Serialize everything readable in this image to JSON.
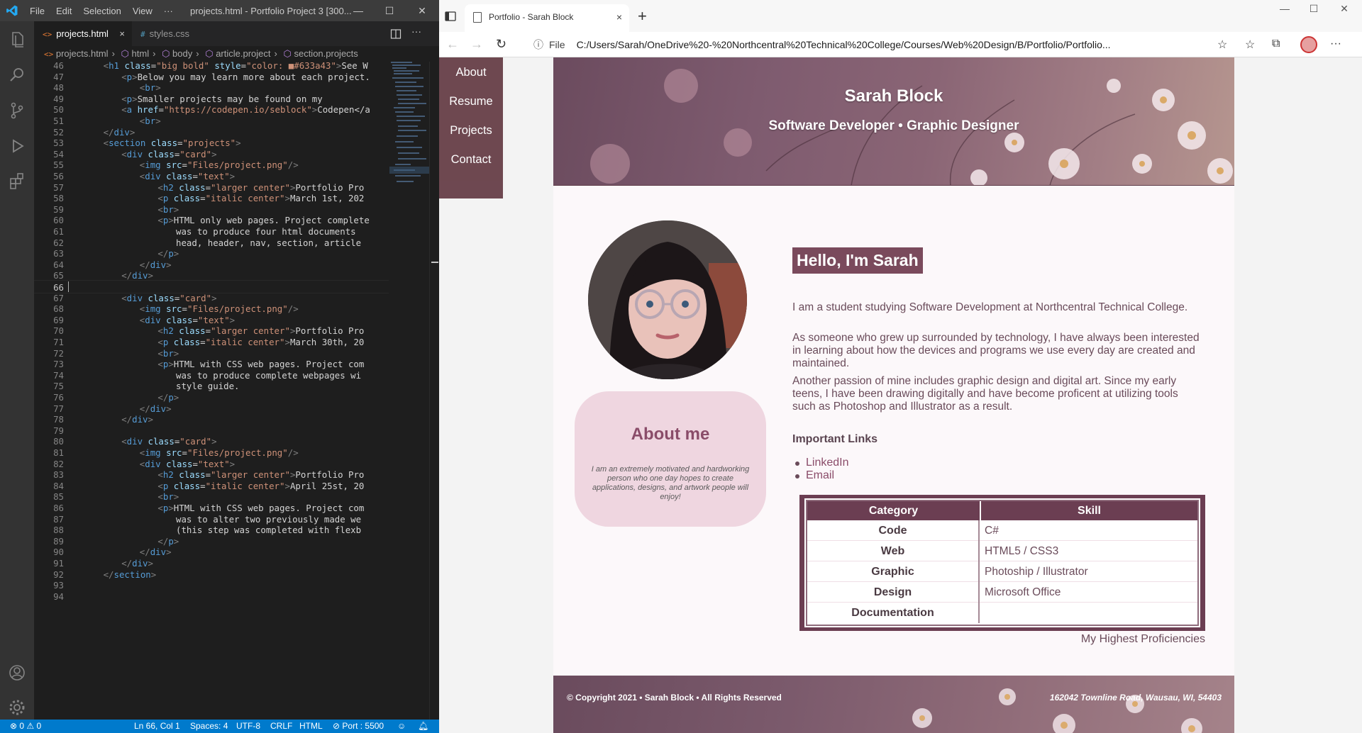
{
  "vscode": {
    "menu": [
      "File",
      "Edit",
      "Selection",
      "View",
      "···"
    ],
    "title": "projects.html - Portfolio Project 3 [300...",
    "tabs": [
      {
        "icon": "<>",
        "label": "projects.html",
        "close": "×"
      },
      {
        "icon": "#",
        "label": "styles.css",
        "close": ""
      }
    ],
    "breadcrumb": [
      "projects.html",
      "html",
      "body",
      "article.project",
      "section.projects"
    ],
    "lines": [
      {
        "n": "46",
        "code": "<h1 class=\"big bold\" style=\"color: ■#633a43\">See W",
        "indent": 4
      },
      {
        "n": "47",
        "code": "<p>Below you may learn more about each project.",
        "indent": 8
      },
      {
        "n": "48",
        "code": "<br>",
        "indent": 12
      },
      {
        "n": "49",
        "code": "<p>Smaller projects may be found on my",
        "indent": 8
      },
      {
        "n": "50",
        "code": "<a href=\"https://codepen.io/seblock\">Codepen</a",
        "indent": 8
      },
      {
        "n": "51",
        "code": "<br>",
        "indent": 12
      },
      {
        "n": "52",
        "code": "</div>",
        "indent": 4
      },
      {
        "n": "53",
        "code": "<section class=\"projects\">",
        "indent": 4
      },
      {
        "n": "54",
        "code": "<div class=\"card\">",
        "indent": 8
      },
      {
        "n": "55",
        "code": "<img src=\"Files/project.png\"/>",
        "indent": 12
      },
      {
        "n": "56",
        "code": "<div class=\"text\">",
        "indent": 12
      },
      {
        "n": "57",
        "code": "<h2 class=\"larger center\">Portfolio Pro",
        "indent": 16
      },
      {
        "n": "58",
        "code": "<p class=\"italic center\">March 1st, 202",
        "indent": 16
      },
      {
        "n": "59",
        "code": "<br>",
        "indent": 16
      },
      {
        "n": "60",
        "code": "<p>HTML only web pages. Project complete",
        "indent": 16
      },
      {
        "n": "61",
        "code": "was to produce four html documents ",
        "indent": 20
      },
      {
        "n": "62",
        "code": "head, header, nav, section, article",
        "indent": 20
      },
      {
        "n": "63",
        "code": "</p>",
        "indent": 16
      },
      {
        "n": "64",
        "code": "</div>",
        "indent": 12
      },
      {
        "n": "65",
        "code": "</div>",
        "indent": 8
      },
      {
        "n": "66",
        "code": "",
        "indent": 0
      },
      {
        "n": "67",
        "code": "<div class=\"card\">",
        "indent": 8
      },
      {
        "n": "68",
        "code": "<img src=\"Files/project.png\"/>",
        "indent": 12
      },
      {
        "n": "69",
        "code": "<div class=\"text\">",
        "indent": 12
      },
      {
        "n": "70",
        "code": "<h2 class=\"larger center\">Portfolio Pro",
        "indent": 16
      },
      {
        "n": "71",
        "code": "<p class=\"italic center\">March 30th, 20",
        "indent": 16
      },
      {
        "n": "72",
        "code": "<br>",
        "indent": 16
      },
      {
        "n": "73",
        "code": "<p>HTML with CSS web pages. Project com",
        "indent": 16
      },
      {
        "n": "74",
        "code": "was to produce complete webpages wi",
        "indent": 20
      },
      {
        "n": "75",
        "code": "style guide.",
        "indent": 20
      },
      {
        "n": "76",
        "code": "</p>",
        "indent": 16
      },
      {
        "n": "77",
        "code": "</div>",
        "indent": 12
      },
      {
        "n": "78",
        "code": "</div>",
        "indent": 8
      },
      {
        "n": "79",
        "code": "",
        "indent": 0
      },
      {
        "n": "80",
        "code": "<div class=\"card\">",
        "indent": 8
      },
      {
        "n": "81",
        "code": "<img src=\"Files/project.png\"/>",
        "indent": 12
      },
      {
        "n": "82",
        "code": "<div class=\"text\">",
        "indent": 12
      },
      {
        "n": "83",
        "code": "<h2 class=\"larger center\">Portfolio Pro",
        "indent": 16
      },
      {
        "n": "84",
        "code": "<p class=\"italic center\">April 25st, 20",
        "indent": 16
      },
      {
        "n": "85",
        "code": "<br>",
        "indent": 16
      },
      {
        "n": "86",
        "code": "<p>HTML with CSS web pages. Project com",
        "indent": 16
      },
      {
        "n": "87",
        "code": "was to alter two previously made we",
        "indent": 20
      },
      {
        "n": "88",
        "code": "(this step was completed with flexb",
        "indent": 20
      },
      {
        "n": "89",
        "code": "</p>",
        "indent": 16
      },
      {
        "n": "90",
        "code": "</div>",
        "indent": 12
      },
      {
        "n": "91",
        "code": "</div>",
        "indent": 8
      },
      {
        "n": "92",
        "code": "</section>",
        "indent": 4
      },
      {
        "n": "93",
        "code": "",
        "indent": 0
      },
      {
        "n": "94",
        "code": "",
        "indent": 0
      }
    ],
    "current_line": "66",
    "status": {
      "problems": "⊗ 0 ⚠ 0",
      "position": "Ln 66, Col 1",
      "spaces": "Spaces: 4",
      "encoding": "UTF-8",
      "eol": "CRLF",
      "language": "HTML",
      "port": "⊘ Port : 5500"
    },
    "accent_color": "#007acc"
  },
  "browser": {
    "tab_title": "Portfolio - Sarah Block",
    "tab_close": "×",
    "new_tab": "+",
    "address_prefix": "File",
    "address": "C:/Users/Sarah/OneDrive%20-%20Northcentral%20Technical%20College/Courses/Web%20Design/B/Portfolio/Portfolio...",
    "window_controls": [
      "—",
      "☐",
      "✕"
    ]
  },
  "site": {
    "nav": [
      "About",
      "Resume",
      "Projects",
      "Contact"
    ],
    "name": "Sarah Block",
    "tagline": "Software Developer • Graphic Designer",
    "about_card": {
      "title": "About me",
      "text": "I am an extremely motivated and hardworking person who one day hopes to create applications, designs, and artwork people will enjoy!"
    },
    "hello": "Hello, I'm Sarah",
    "paragraphs": [
      "I am a student studying Software Development at Northcentral Technical College.",
      "As someone who grew up surrounded by technology, I have always been interested in learning about how the devices and programs we use every day are created and maintained.",
      "Another passion of mine includes graphic design and digital art. Since my early teens, I have been drawing digitally and have become proficent at utilizing tools such as Photoshop and Illustrator as a result."
    ],
    "links_title": "Important Links",
    "links": [
      "LinkedIn",
      "Email"
    ],
    "skills": {
      "headers": [
        "Category",
        "Skill"
      ],
      "rows": [
        [
          "Code",
          "C#"
        ],
        [
          "Web",
          "HTML5 / CSS3"
        ],
        [
          "Graphic",
          "Photoship / Illustrator"
        ],
        [
          "Design",
          "Microsoft Office"
        ],
        [
          "Documentation",
          ""
        ]
      ],
      "caption": "My Highest Proficiencies"
    },
    "footer": {
      "copyright": "© Copyright 2021 • Sarah Block • All Rights Reserved",
      "address": "162042 Townline Road, Wausau, WI, 54403"
    },
    "colors": {
      "brand": "#633a43",
      "accent": "#8a4c69",
      "card": "#efd6e0"
    }
  }
}
